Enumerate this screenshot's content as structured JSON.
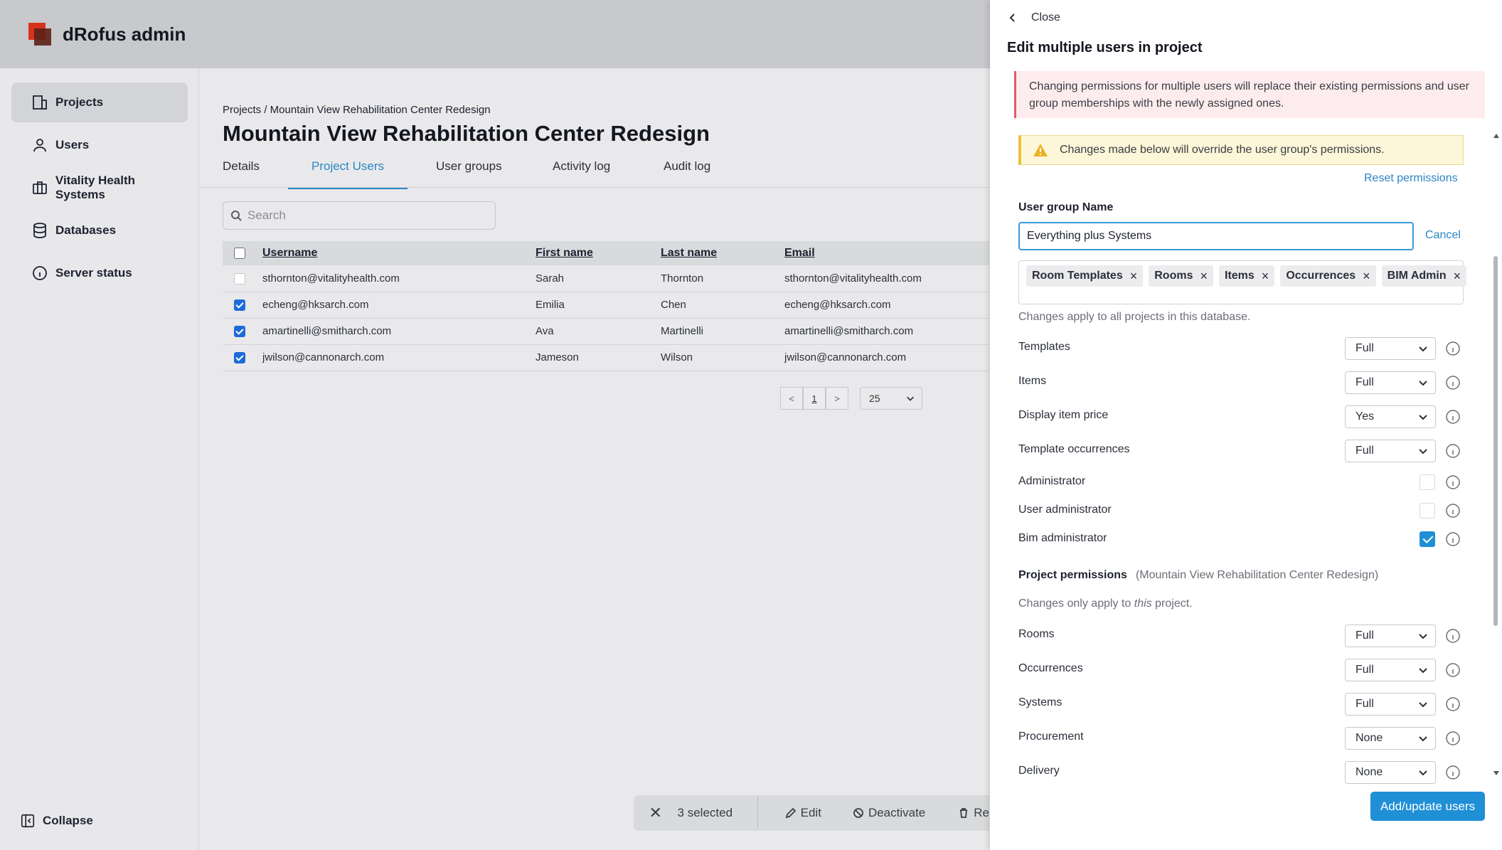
{
  "app": {
    "title": "dRofus admin"
  },
  "sidebar": {
    "items": [
      {
        "label": "Projects",
        "icon": "building-icon"
      },
      {
        "label": "Users",
        "icon": "user-icon"
      },
      {
        "label": "Vitality Health Systems",
        "icon": "briefcase-icon"
      },
      {
        "label": "Databases",
        "icon": "database-icon"
      },
      {
        "label": "Server status",
        "icon": "info-icon"
      }
    ],
    "collapse_label": "Collapse"
  },
  "main": {
    "breadcrumb": "Projects / Mountain View Rehabilitation Center Redesign",
    "title": "Mountain View Rehabilitation Center Redesign",
    "tabs": [
      {
        "label": "Details"
      },
      {
        "label": "Project Users"
      },
      {
        "label": "User groups"
      },
      {
        "label": "Activity log"
      },
      {
        "label": "Audit log"
      }
    ],
    "search_placeholder": "Search",
    "table": {
      "headers": [
        "Username",
        "First name",
        "Last name",
        "Email"
      ],
      "rows": [
        {
          "username": "sthornton@vitalityhealth.com",
          "first": "Sarah",
          "last": "Thornton",
          "email": "sthornton@vitalityhealth.com",
          "checked": false
        },
        {
          "username": "echeng@hksarch.com",
          "first": "Emilia",
          "last": "Chen",
          "email": "echeng@hksarch.com",
          "checked": true
        },
        {
          "username": "amartinelli@smitharch.com",
          "first": "Ava",
          "last": "Martinelli",
          "email": "amartinelli@smitharch.com",
          "checked": true
        },
        {
          "username": "jwilson@cannonarch.com",
          "first": "Jameson",
          "last": "Wilson",
          "email": "jwilson@cannonarch.com",
          "checked": true
        }
      ]
    },
    "pager": {
      "prev": "<",
      "page": "1",
      "next": ">",
      "page_size": "25"
    },
    "selection_bar": {
      "selected": "3 selected",
      "edit": "Edit",
      "deactivate": "Deactivate",
      "remove": "Re"
    }
  },
  "drawer": {
    "close_label": "Close",
    "title": "Edit multiple users in project",
    "error_alert": "Changing permissions for multiple users will replace their existing permissions and user group memberships with the newly assigned ones.",
    "warning_alert": "Changes made below will override the user group's permissions.",
    "reset_label": "Reset permissions",
    "user_group_label": "User group Name",
    "user_group_value": "Everything plus Systems",
    "cancel_label": "Cancel",
    "tags": [
      "Room Templates",
      "Rooms",
      "Items",
      "Occurrences",
      "BIM Admin"
    ],
    "database_note": "Changes apply to all projects in this database.",
    "database_permissions": [
      {
        "label": "Templates",
        "value": "Full"
      },
      {
        "label": "Items",
        "value": "Full"
      },
      {
        "label": "Display item price",
        "value": "Yes"
      },
      {
        "label": "Template occurrences",
        "value": "Full"
      }
    ],
    "flags": [
      {
        "label": "Administrator",
        "checked": false
      },
      {
        "label": "User administrator",
        "checked": false
      },
      {
        "label": "Bim administrator",
        "checked": true
      }
    ],
    "project_permissions_heading": "Project permissions",
    "project_permissions_sub": "(Mountain View Rehabilitation Center Redesign)",
    "project_note_prefix": "Changes only apply to ",
    "project_note_em": "this",
    "project_note_suffix": " project.",
    "project_permissions": [
      {
        "label": "Rooms",
        "value": "Full"
      },
      {
        "label": "Occurrences",
        "value": "Full"
      },
      {
        "label": "Systems",
        "value": "Full"
      },
      {
        "label": "Procurement",
        "value": "None"
      },
      {
        "label": "Delivery",
        "value": "None"
      }
    ],
    "submit_label": "Add/update users"
  },
  "colors": {
    "accent": "#2b86c4",
    "primary_button": "#1f8fd6",
    "checkbox": "#1f6ad9",
    "error_bg": "#fdecee",
    "warning_bg": "#fdf6d8"
  }
}
